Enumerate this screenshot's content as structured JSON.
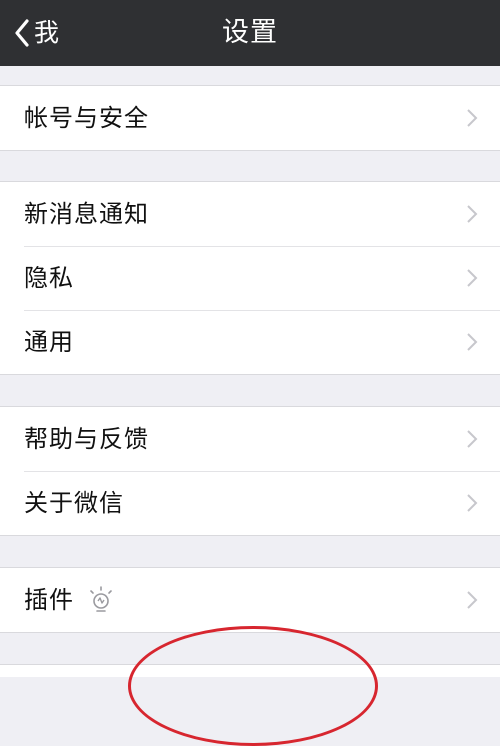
{
  "nav": {
    "back_label": "我",
    "title": "设置"
  },
  "groups": [
    {
      "items": [
        {
          "label": "帐号与安全"
        }
      ]
    },
    {
      "items": [
        {
          "label": "新消息通知"
        },
        {
          "label": "隐私"
        },
        {
          "label": "通用"
        }
      ]
    },
    {
      "items": [
        {
          "label": "帮助与反馈"
        },
        {
          "label": "关于微信"
        }
      ]
    },
    {
      "items": [
        {
          "label": "插件",
          "icon": "bulb-icon"
        }
      ]
    }
  ],
  "icons": {
    "back": "chevron-left-icon",
    "row_arrow": "chevron-right-icon",
    "plugin": "bulb-icon"
  },
  "colors": {
    "nav_background": "#2f3033",
    "page_background": "#efeff4",
    "annotation": "#d7262f",
    "chevron": "#c7c7cc"
  }
}
